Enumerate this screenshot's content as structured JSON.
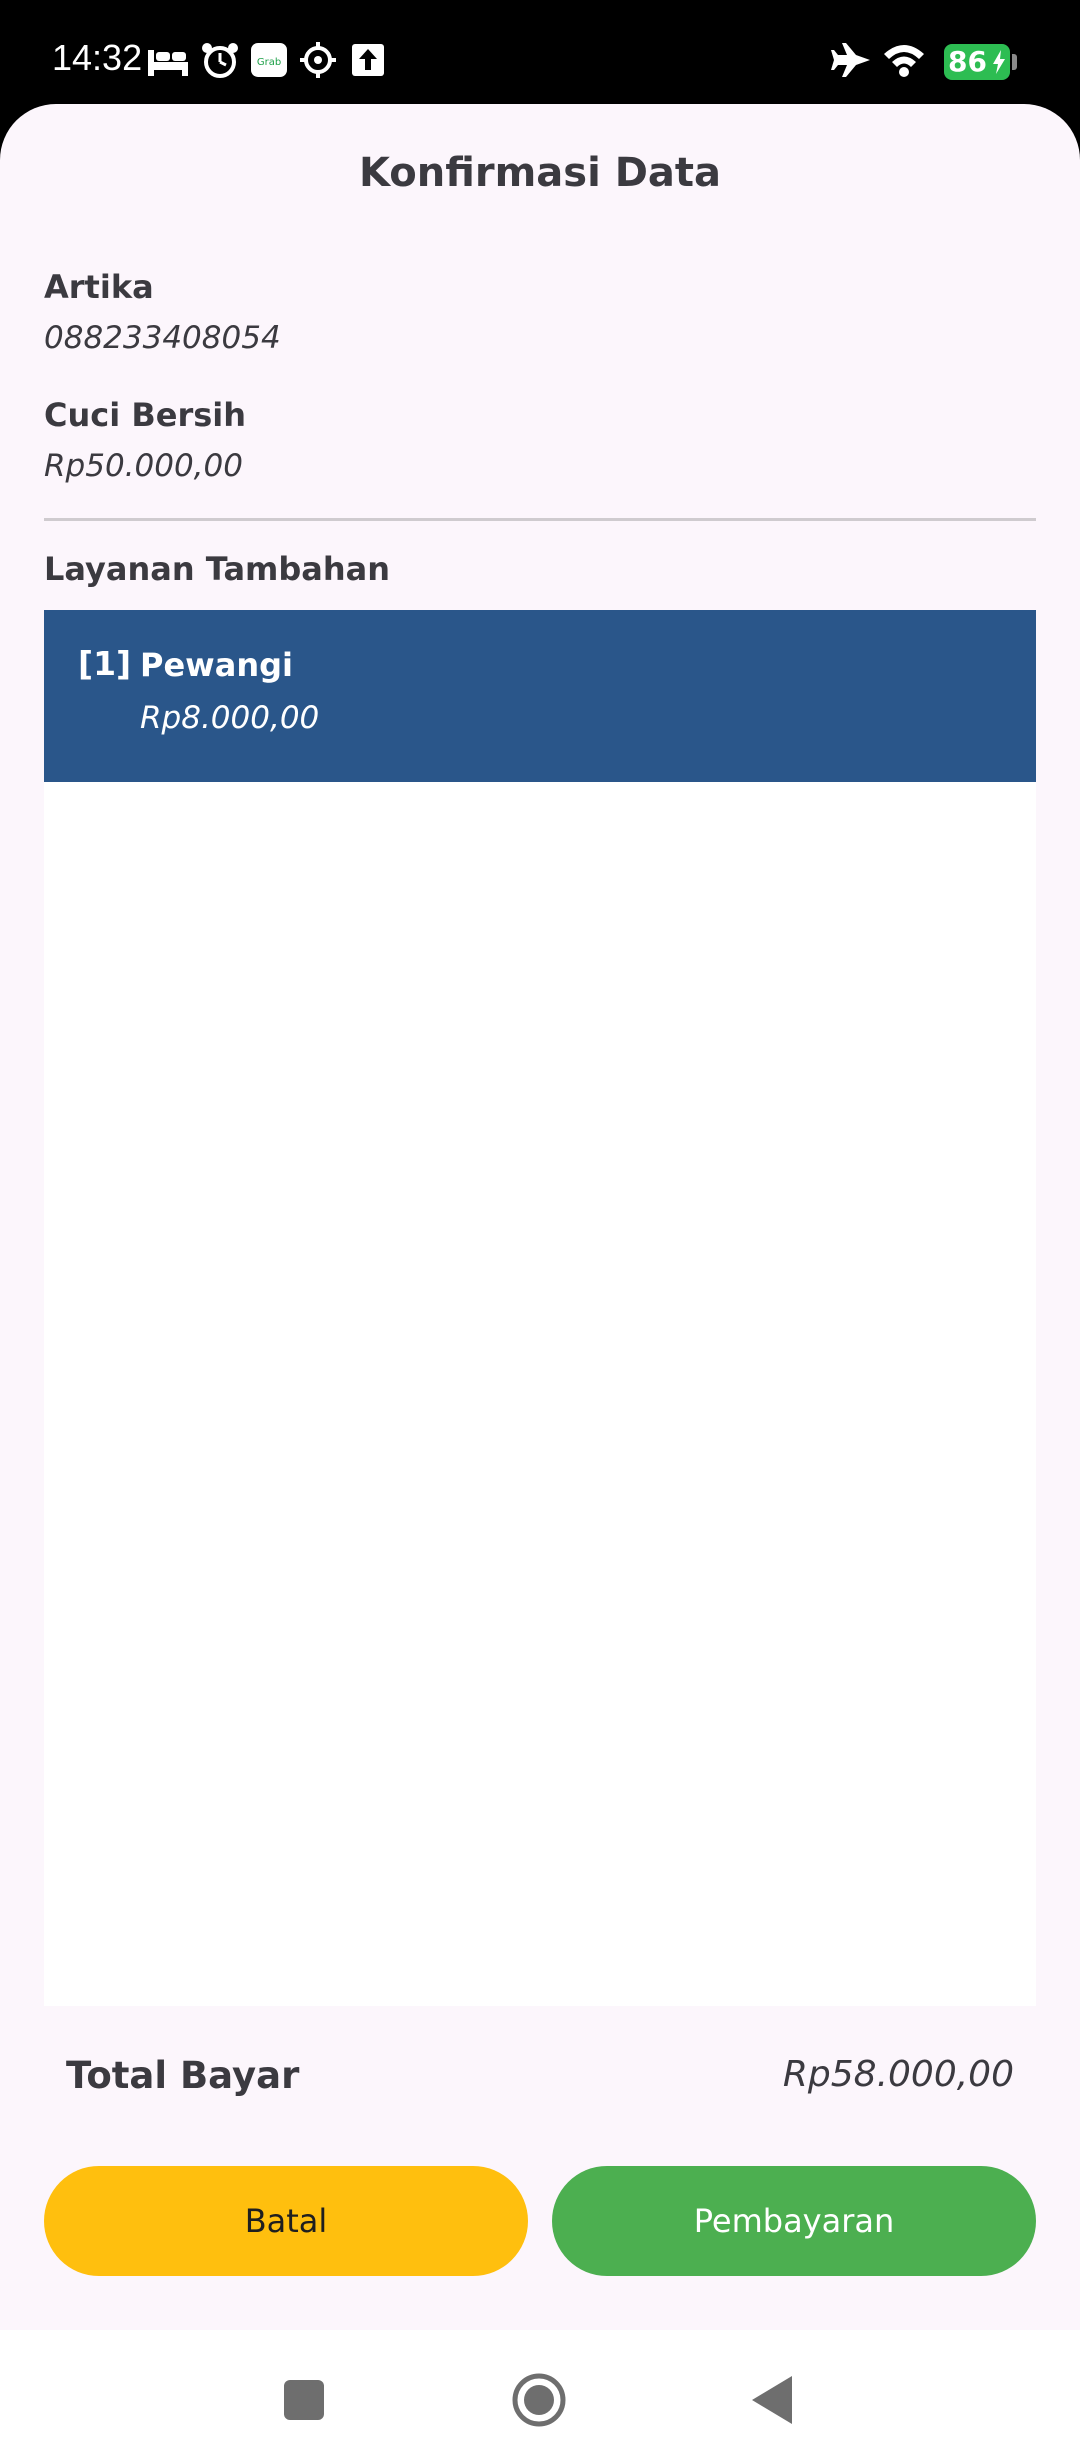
{
  "status_bar": {
    "time": "14:32",
    "battery": "86",
    "icons": [
      "bed-icon",
      "alarm-icon",
      "grab-icon",
      "settings-icon",
      "upload-icon",
      "airplane-icon",
      "wifi-icon",
      "battery-icon"
    ]
  },
  "dialog": {
    "title": "Konfirmasi Data",
    "customer_name": "Artika",
    "customer_phone": "088233408054",
    "service_name": "Cuci Bersih",
    "service_price": "Rp50.000,00",
    "extras_heading": "Layanan Tambahan",
    "extras": [
      {
        "index": "[1]",
        "name": "Pewangi",
        "price": "Rp8.000,00"
      }
    ],
    "total_label": "Total Bayar",
    "total_value": "Rp58.000,00",
    "cancel_label": "Batal",
    "pay_label": "Pembayaran"
  },
  "colors": {
    "sheet_bg": "#fcf6fc",
    "item_bg": "#2a568a",
    "cancel_bg": "#ffbf0e",
    "pay_bg": "#4caf50",
    "battery": "#2dbd52"
  },
  "nav_bar": {
    "icons": [
      "recents-icon",
      "home-icon",
      "back-icon"
    ]
  }
}
